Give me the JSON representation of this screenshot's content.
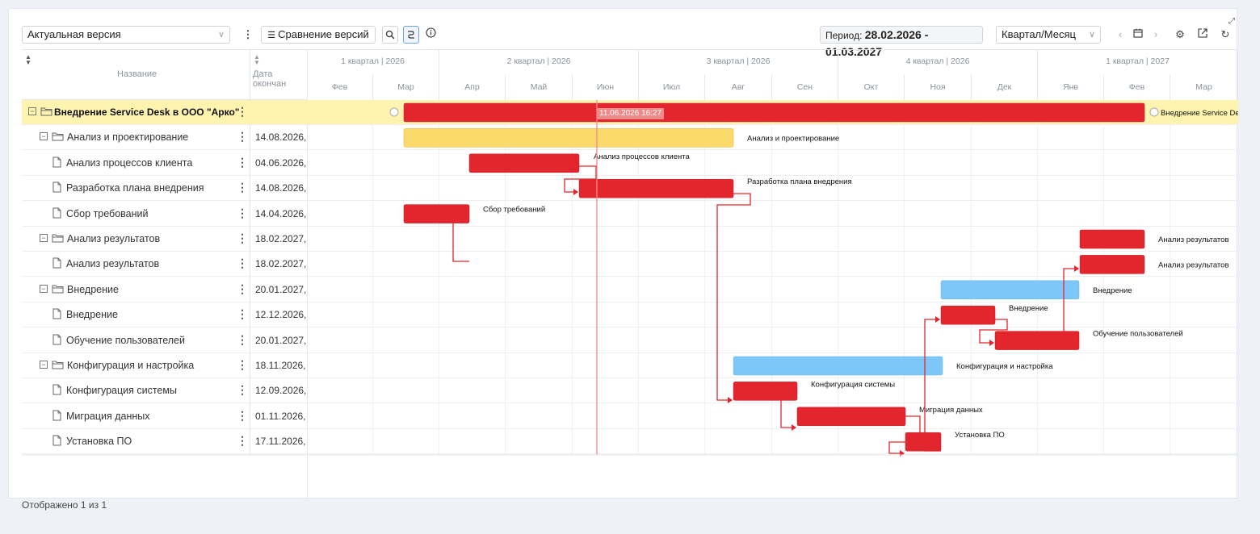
{
  "toolbar": {
    "version_select": "Актуальная версия",
    "compare_button": "Сравнение версий",
    "period_label": "Период: ",
    "period_value": "28.02.2026 - 01.03.2027",
    "scale_select": "Квартал/Месяц"
  },
  "columns": {
    "name": "Название",
    "end_date": "Дата окончан"
  },
  "timeline": {
    "quarters": [
      "1 квартал | 2026",
      "2 квартал | 2026",
      "3 квартал | 2026",
      "4 квартал | 2026",
      "1 квартал | 2027"
    ],
    "months": [
      "Фев",
      "Мар",
      "Апр",
      "Май",
      "Июн",
      "Июл",
      "Авг",
      "Сен",
      "Окт",
      "Ноя",
      "Дек",
      "Янв",
      "Фев",
      "Мар"
    ],
    "today_marker": "11.06.2026 16:27"
  },
  "tasks": [
    {
      "name": "Внедрение Service Desk в ООО \"Арко\"",
      "date": "",
      "bar_label": "Внедрение Service De"
    },
    {
      "name": "Анализ и проектирование",
      "date": "14.08.2026,",
      "bar_label": "Анализ и проектирование"
    },
    {
      "name": "Анализ процессов клиента",
      "date": "04.06.2026,",
      "bar_label": "Анализ процессов клиента"
    },
    {
      "name": "Разработка плана внедрения",
      "date": "14.08.2026,",
      "bar_label": "Разработка плана внедрения"
    },
    {
      "name": "Сбор требований",
      "date": "14.04.2026,",
      "bar_label": "Сбор требований"
    },
    {
      "name": "Анализ результатов",
      "date": "18.02.2027,",
      "bar_label": "Анализ результатов"
    },
    {
      "name": "Анализ результатов",
      "date": "18.02.2027,",
      "bar_label": "Анализ результатов"
    },
    {
      "name": "Внедрение",
      "date": "20.01.2027,",
      "bar_label": "Внедрение"
    },
    {
      "name": "Внедрение",
      "date": "12.12.2026,",
      "bar_label": "Внедрение"
    },
    {
      "name": "Обучение пользователей",
      "date": "20.01.2027,",
      "bar_label": "Обучение пользователей"
    },
    {
      "name": "Конфигурация и настройка",
      "date": "18.11.2026,",
      "bar_label": "Конфигурация и настройка"
    },
    {
      "name": "Конфигурация системы",
      "date": "12.09.2026,",
      "bar_label": "Конфигурация системы"
    },
    {
      "name": "Миграция данных",
      "date": "01.11.2026,",
      "bar_label": "Миграция данных"
    },
    {
      "name": "Установка ПО",
      "date": "17.11.2026,",
      "bar_label": "Установка ПО"
    }
  ],
  "colors": {
    "critical": "#e3262e",
    "group_normal": "#fcd96b",
    "group_blue": "#7cc7f7",
    "today": "#f28c8c",
    "summary_row": "#fff3b0"
  },
  "footer": "Отображено 1 из 1"
}
